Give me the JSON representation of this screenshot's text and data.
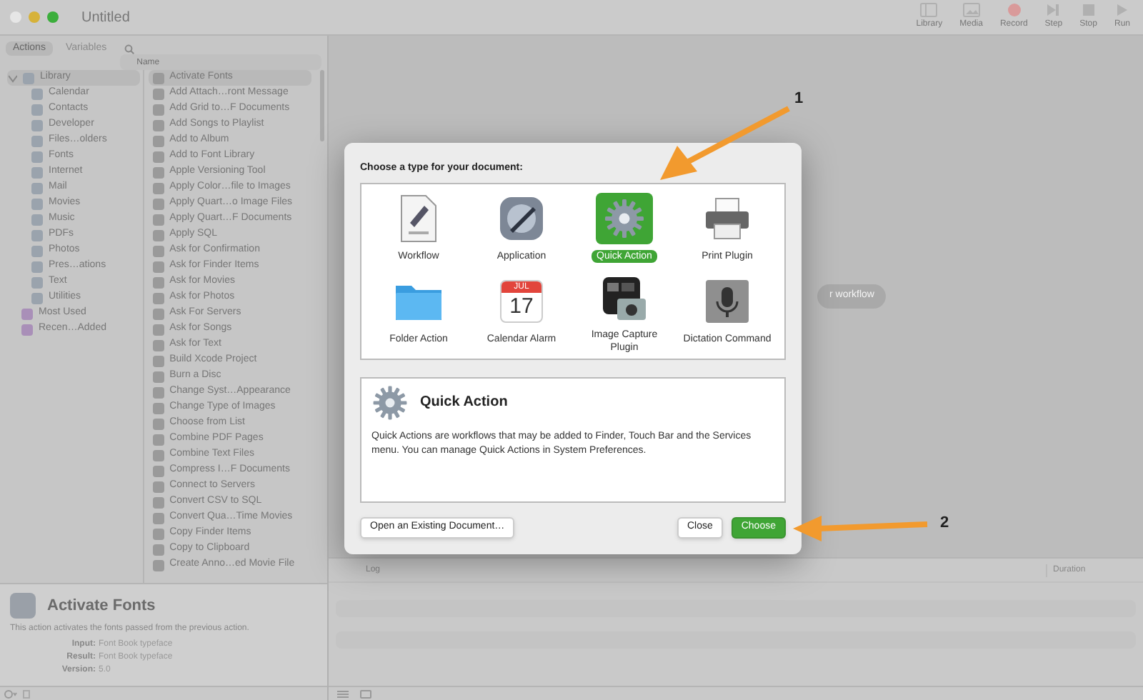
{
  "window": {
    "title": "Untitled"
  },
  "toolbar": [
    {
      "label": "Library",
      "kind": "library"
    },
    {
      "label": "Media",
      "kind": "media"
    },
    {
      "label": "Record",
      "kind": "record"
    },
    {
      "label": "Step",
      "kind": "step"
    },
    {
      "label": "Stop",
      "kind": "stop"
    },
    {
      "label": "Run",
      "kind": "run"
    }
  ],
  "sidebar_tabs": [
    {
      "label": "Actions",
      "selected": true
    },
    {
      "label": "Variables",
      "selected": false
    }
  ],
  "search": {
    "placeholder": "Name"
  },
  "library": [
    {
      "label": "Library",
      "kind": "library",
      "expanded": true,
      "selected": true,
      "children": [
        {
          "label": "Calendar",
          "kind": "category"
        },
        {
          "label": "Contacts",
          "kind": "category"
        },
        {
          "label": "Developer",
          "kind": "category"
        },
        {
          "label": "Files…olders",
          "kind": "category"
        },
        {
          "label": "Fonts",
          "kind": "category"
        },
        {
          "label": "Internet",
          "kind": "category"
        },
        {
          "label": "Mail",
          "kind": "category"
        },
        {
          "label": "Movies",
          "kind": "category"
        },
        {
          "label": "Music",
          "kind": "category"
        },
        {
          "label": "PDFs",
          "kind": "category"
        },
        {
          "label": "Photos",
          "kind": "category"
        },
        {
          "label": "Pres…ations",
          "kind": "category"
        },
        {
          "label": "Text",
          "kind": "category"
        },
        {
          "label": "Utilities",
          "kind": "category"
        }
      ]
    },
    {
      "label": "Most Used",
      "kind": "smart",
      "selected": false
    },
    {
      "label": "Recen…Added",
      "kind": "smart",
      "selected": false
    }
  ],
  "actions": [
    {
      "label": "Activate Fonts",
      "selected": true
    },
    {
      "label": "Add Attach…ront Message",
      "selected": false
    },
    {
      "label": "Add Grid to…F Documents",
      "selected": false
    },
    {
      "label": "Add Songs to Playlist",
      "selected": false
    },
    {
      "label": "Add to Album",
      "selected": false
    },
    {
      "label": "Add to Font Library",
      "selected": false
    },
    {
      "label": "Apple Versioning Tool",
      "selected": false
    },
    {
      "label": "Apply Color…file to Images",
      "selected": false
    },
    {
      "label": "Apply Quart…o Image Files",
      "selected": false
    },
    {
      "label": "Apply Quart…F Documents",
      "selected": false
    },
    {
      "label": "Apply SQL",
      "selected": false
    },
    {
      "label": "Ask for Confirmation",
      "selected": false
    },
    {
      "label": "Ask for Finder Items",
      "selected": false
    },
    {
      "label": "Ask for Movies",
      "selected": false
    },
    {
      "label": "Ask for Photos",
      "selected": false
    },
    {
      "label": "Ask For Servers",
      "selected": false
    },
    {
      "label": "Ask for Songs",
      "selected": false
    },
    {
      "label": "Ask for Text",
      "selected": false
    },
    {
      "label": "Build Xcode Project",
      "selected": false
    },
    {
      "label": "Burn a Disc",
      "selected": false
    },
    {
      "label": "Change Syst…Appearance",
      "selected": false
    },
    {
      "label": "Change Type of Images",
      "selected": false
    },
    {
      "label": "Choose from List",
      "selected": false
    },
    {
      "label": "Combine PDF Pages",
      "selected": false
    },
    {
      "label": "Combine Text Files",
      "selected": false
    },
    {
      "label": "Compress I…F Documents",
      "selected": false
    },
    {
      "label": "Connect to Servers",
      "selected": false
    },
    {
      "label": "Convert CSV to SQL",
      "selected": false
    },
    {
      "label": "Convert Qua…Time Movies",
      "selected": false
    },
    {
      "label": "Copy Finder Items",
      "selected": false
    },
    {
      "label": "Copy to Clipboard",
      "selected": false
    },
    {
      "label": "Create Anno…ed Movie File",
      "selected": false
    }
  ],
  "description": {
    "title": "Activate Fonts",
    "text": "This action activates the fonts passed from the previous action.",
    "fields": [
      {
        "label": "Input:",
        "value": "Font Book typeface"
      },
      {
        "label": "Result:",
        "value": "Font Book typeface"
      },
      {
        "label": "Version:",
        "value": "5.0"
      }
    ]
  },
  "canvas_hint": "r workflow",
  "log": {
    "columns": [
      "Log",
      "Duration"
    ]
  },
  "dialog": {
    "prompt": "Choose a type for your document:",
    "types": [
      {
        "label": "Workflow",
        "kind": "workflow",
        "selected": false
      },
      {
        "label": "Application",
        "kind": "application",
        "selected": false
      },
      {
        "label": "Quick Action",
        "kind": "quick-action",
        "selected": true
      },
      {
        "label": "Print Plugin",
        "kind": "printer",
        "selected": false
      },
      {
        "label": "Folder Action",
        "kind": "folder",
        "selected": false
      },
      {
        "label": "Calendar Alarm",
        "kind": "calendar",
        "selected": false,
        "icon_month": "JUL",
        "icon_day": "17"
      },
      {
        "label": "Image Capture Plugin",
        "kind": "camera",
        "selected": false
      },
      {
        "label": "Dictation Command",
        "kind": "microphone",
        "selected": false
      }
    ],
    "detail": {
      "title": "Quick Action",
      "text": "Quick Actions are workflows that may be added to Finder, Touch Bar and the Services menu. You can manage Quick Actions in System Preferences."
    },
    "buttons": [
      {
        "label": "Open an Existing Document…",
        "kind": "secondary"
      },
      {
        "label": "Close",
        "kind": "normal"
      },
      {
        "label": "Choose",
        "kind": "default"
      }
    ]
  },
  "annotations": [
    {
      "label": "1"
    },
    {
      "label": "2"
    }
  ]
}
